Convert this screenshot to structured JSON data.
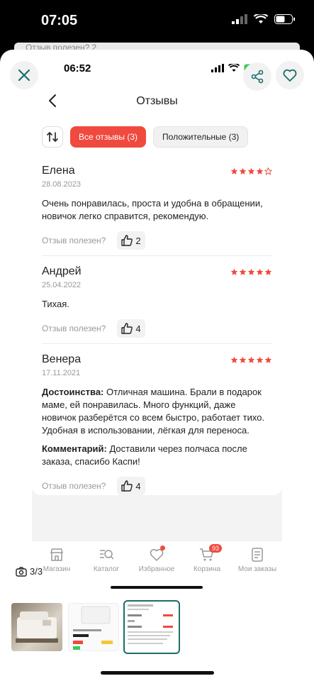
{
  "device": {
    "outer_time": "07:05",
    "inner_time": "06:52"
  },
  "background_hint": "Отзыв полезен?   2",
  "header": {
    "title": "Отзывы"
  },
  "filters": {
    "all": "Все отзывы (3)",
    "positive": "Положительные (3)"
  },
  "reviews": [
    {
      "name": "Елена",
      "date": "28.08.2023",
      "rating": 4,
      "text": "Очень понравилась, проста и удобна в обращении, новичок легко справится, рекомендую.",
      "helpful_label": "Отзыв полезен?",
      "likes": "2"
    },
    {
      "name": "Андрей",
      "date": "25.04.2022",
      "rating": 5,
      "text": "Тихая.",
      "helpful_label": "Отзыв полезен?",
      "likes": "4"
    },
    {
      "name": "Венера",
      "date": "17.11.2021",
      "rating": 5,
      "pros_label": "Достоинства:",
      "pros_text": " Отличная машина. Брали в подарок маме, ей понравилась. Много функций, даже новичок разберётся со всем быстро, работает тихо. Удобная в использовании, лёгкая для переноса.",
      "comment_label": "Комментарий:",
      "comment_text": " Доставили через полчаса после заказа, спасибо Каспи!",
      "helpful_label": "Отзыв полезен?",
      "likes": "4"
    }
  ],
  "bottom_nav": {
    "shop": "Магазин",
    "catalog": "Каталог",
    "favorites": "Избранное",
    "cart": "Корзина",
    "cart_badge": "93",
    "orders": "Мои заказы"
  },
  "gallery": {
    "counter": "3/3"
  },
  "colors": {
    "accent": "#f0493e",
    "thumb_border": "#1a6e6a"
  }
}
